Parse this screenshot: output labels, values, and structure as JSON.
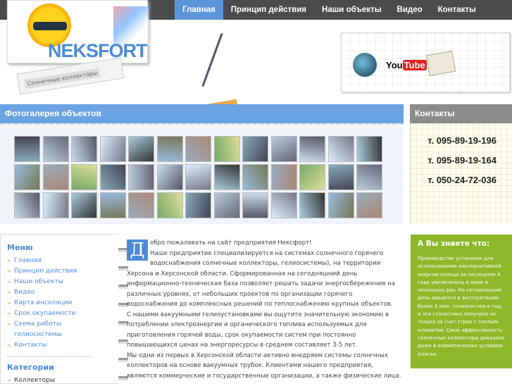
{
  "nav": {
    "items": [
      "Главная",
      "Принцип действия",
      "Наши объекты",
      "Видео",
      "Контакты"
    ]
  },
  "logo": {
    "brand": "NEKSFORT",
    "tagline": "Солнечные коллекторы"
  },
  "social": {
    "youtube_you": "You",
    "youtube_tube": "Tube"
  },
  "gallery": {
    "title": "Фотогалерея объектов",
    "count": 39
  },
  "contacts": {
    "title": "Контакты",
    "phones": [
      "т. 095-89-19-196",
      "т. 095-89-19-164",
      "т. 050-24-72-036"
    ]
  },
  "menu": {
    "title": "Меню",
    "items": [
      "Главная",
      "Принцип действия",
      "Наши объекты",
      "Видео",
      "Карта инсоляции",
      "Срок окупаемости",
      "Схема работы гелиосистемы",
      "Контакты"
    ],
    "categories_title": "Категории",
    "categories": [
      "Коллекторы"
    ]
  },
  "content": {
    "dropcap": "Д",
    "paragraphs": [
      "обро пожаловать на сайт предприятия Нексфорт!",
      "Наше предприятие специализируется на системах солнечного горячего водоснабжения  солнечные коллекторы, гелиосистемы), на территории Херсона и Херсонской области. Сформированная на сегодняшний день информационно-техническая база позволяет решать задачи энергосбережения на различных уровнях, от небольших проектов по организации горячего водоснабжения до комплексных решений по теплоснабжению крупных объектов.",
      "С нашими вакуумными гелиоустановками вы ощутите значительную экономию в потреблении электроэнергии и органического топлива используемых для приготовления горячей воды, срок окупаемости систем при постоянно повышающихся ценах на энергоресурсы в среднем составляет 3-5 лет.",
      "Мы одни из первых в Херсонской области активно внедряем системы солнечных коллекторов на основе вакуумных трубок. Клиентами нашего предприятия, являются коммерческие и государственные организации, а также физические лица."
    ]
  },
  "fact": {
    "title": "А Вы знаете что:",
    "text": "Производство установок для использования альтернативной энергии солнца за последние 4 года увеличилось в мире в несколько раз. На сегодняшний день вводится в эксплуатацию более 3 млн. гелиосистем в год, и эта статистика получена не только за счет стран с теплым климатом. Свою эффективность солнечные коллекторы доказали даже в климатических условиях Аляски."
  }
}
